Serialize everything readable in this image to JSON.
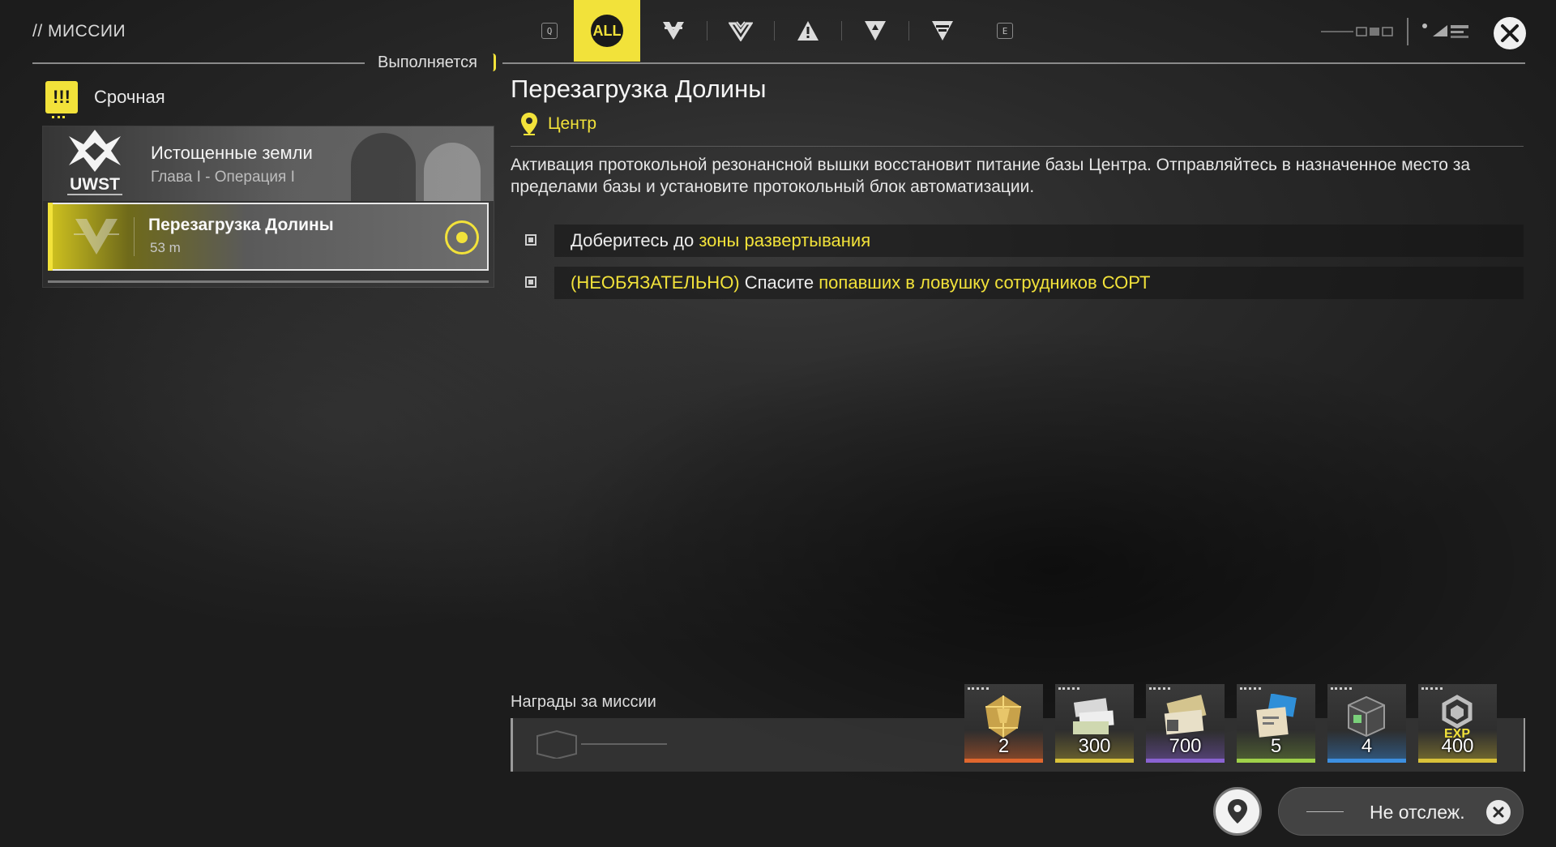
{
  "header": {
    "title": "// МИССИИ",
    "status": "Выполняется",
    "key_left": "Q",
    "key_right": "E",
    "all_tab_label": "ALL"
  },
  "filter_tabs": [
    {
      "icon": "all-missions-icon",
      "active": true
    },
    {
      "icon": "story-mission-icon"
    },
    {
      "icon": "faction-mission-icon"
    },
    {
      "icon": "side-mission-icon"
    },
    {
      "icon": "event-mission-icon"
    },
    {
      "icon": "daily-mission-icon"
    }
  ],
  "category": {
    "label": "Срочная",
    "icon_glyph": "!!!"
  },
  "chapter": {
    "logo_text": "UWST",
    "title": "Истощенные земли",
    "subtitle": "Глава I - Операция I"
  },
  "mission_item": {
    "title": "Перезагрузка Долины",
    "distance": "53 m"
  },
  "detail": {
    "title": "Перезагрузка Долины",
    "location": "Центр",
    "description": "Активация протокольной резонансной вышки восстановит питание базы Центра. Отправляйтесь в назначенное место за пределами базы и установите протокольный блок автоматизации."
  },
  "objectives": [
    {
      "prefix": "Доберитесь до ",
      "highlight": "зоны развертывания"
    },
    {
      "optional_tag": "(НЕОБЯЗАТЕЛЬНО)",
      "middle": " Спасите ",
      "highlight": "попавших в ловушку сотрудников СОРТ"
    }
  ],
  "rewards": {
    "label": "Награды за миссии",
    "items": [
      {
        "icon": "gold-crystal-icon",
        "quantity": "2",
        "rarity_color": "#e0672e"
      },
      {
        "icon": "credit-tickets-icon",
        "quantity": "300",
        "rarity_color": "#d9c23a"
      },
      {
        "icon": "voucher-stack-icon",
        "quantity": "700",
        "rarity_color": "#8a63d2"
      },
      {
        "icon": "exp-card-icon",
        "quantity": "5",
        "rarity_color": "#9fd14a"
      },
      {
        "icon": "module-crate-icon",
        "quantity": "4",
        "rarity_color": "#3d8fe0"
      },
      {
        "icon": "exp-token-icon",
        "quantity": "400",
        "rarity_color": "#d9c23a"
      }
    ]
  },
  "footer": {
    "untrack_label": "Не отслеж."
  },
  "colors": {
    "accent": "#f2e23a",
    "background": "#2a2a2a"
  }
}
